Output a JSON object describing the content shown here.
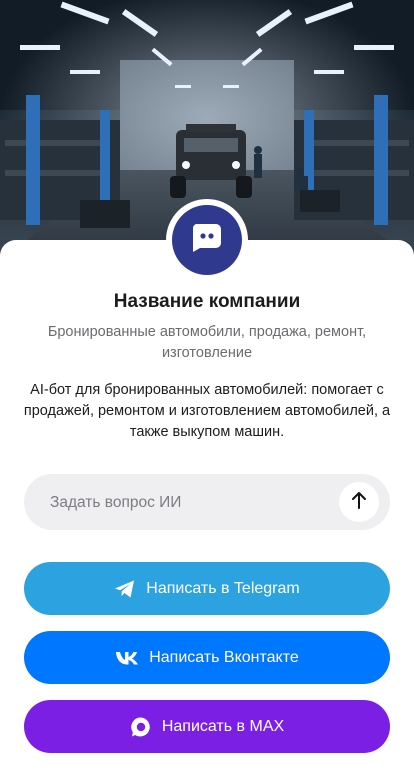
{
  "company": {
    "name": "Название компании",
    "subtitle": "Бронированные автомобили, продажа, ремонт, изготовление",
    "description": "AI-бот для бронированных автомобилей: помогает с продажей, ремонтом и изготовлением автомобилей, а также выкупом машин."
  },
  "ask": {
    "placeholder": "Задать вопрос ИИ"
  },
  "buttons": {
    "telegram": "Написать в Telegram",
    "vk": "Написать Вконтакте",
    "max": "Написать в MAX"
  },
  "icons": {
    "avatar": "chat-bot-icon",
    "send": "arrow-up-icon",
    "telegram": "telegram-icon",
    "vk": "vk-icon",
    "max": "max-icon"
  },
  "colors": {
    "avatar": "#2f3a8f",
    "telegram": "#2ca3e0",
    "vk": "#0077ff",
    "max": "#7b1fe4"
  }
}
